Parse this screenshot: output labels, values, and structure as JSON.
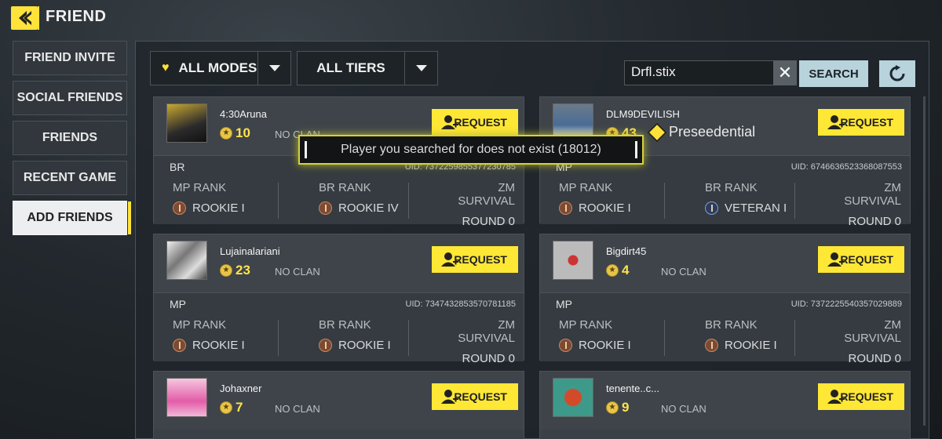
{
  "header": {
    "title": "FRIEND"
  },
  "sidebar": {
    "items": [
      {
        "label": "FRIEND INVITE"
      },
      {
        "label": "SOCIAL FRIENDS"
      },
      {
        "label": "FRIENDS"
      },
      {
        "label": "RECENT GAME"
      },
      {
        "label": "ADD FRIENDS",
        "active": true
      }
    ]
  },
  "filters": {
    "modes": "ALL MODES",
    "tiers": "ALL TIERS"
  },
  "search": {
    "value": "Drfl.stix",
    "button": "SEARCH"
  },
  "toast": {
    "message": "Player you searched for does not exist (18012)"
  },
  "stat_labels": {
    "mp": "MP RANK",
    "br": "BR RANK",
    "zm": "ZM SURVIVAL"
  },
  "request_label": "REQUEST",
  "players": [
    {
      "name": "4:30Aruna",
      "level": "10",
      "clan": "NO CLAN",
      "mode": "BR",
      "uid": "UID: 7372259855377230785",
      "mp_rank": "ROOKIE I",
      "br_rank": "ROOKIE IV",
      "zm": "ROUND 0"
    },
    {
      "name": "DLM9DEVILISH",
      "level": "43",
      "clan": "Preseedential",
      "mode": "MP",
      "uid": "UID: 6746636523368087553",
      "mp_rank": "ROOKIE I",
      "br_rank": "VETERAN I",
      "zm": "ROUND 0"
    },
    {
      "name": "Lujainalariani",
      "level": "23",
      "clan": "NO CLAN",
      "mode": "MP",
      "uid": "UID: 7347432853570781185",
      "mp_rank": "ROOKIE I",
      "br_rank": "ROOKIE I",
      "zm": "ROUND 0"
    },
    {
      "name": "Bigdirt45",
      "level": "4",
      "clan": "NO CLAN",
      "mode": "MP",
      "uid": "UID: 7372225540357029889",
      "mp_rank": "ROOKIE I",
      "br_rank": "ROOKIE I",
      "zm": "ROUND 0"
    },
    {
      "name": "Johaxner",
      "level": "7",
      "clan": "NO CLAN"
    },
    {
      "name": "tenente..c...",
      "level": "9",
      "clan": "NO CLAN"
    }
  ],
  "colors": {
    "accent": "#ffe735",
    "panel": "#3a4045",
    "search_btn": "#b8d3dc"
  }
}
